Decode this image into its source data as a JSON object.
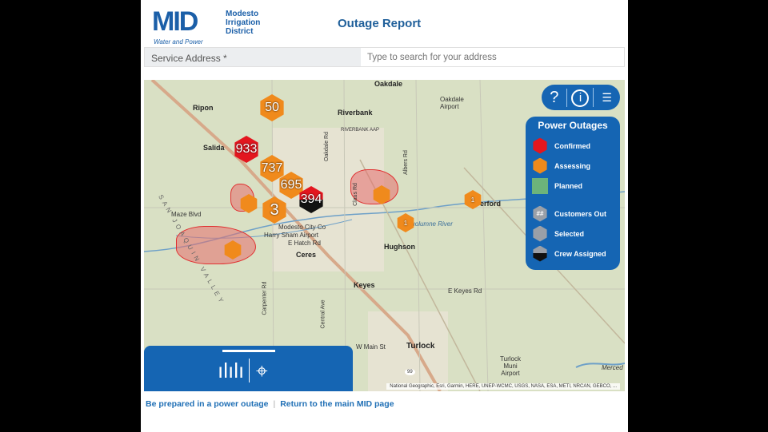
{
  "header": {
    "logo_text": "MID",
    "logo_sub": "Modesto Irrigation District",
    "logo_tagline": "Water and Power",
    "title": "Outage Report"
  },
  "search": {
    "label": "Service Address *",
    "placeholder": "Type to search for your address"
  },
  "map": {
    "labels": [
      "Oakdale",
      "Oakdale Airport",
      "Ripon",
      "Riverbank",
      "RIVERBANK AAP",
      "Salida",
      "Maze Blvd",
      "Modesto City Co",
      "Harry Sham Airport",
      "E Hatch Rd",
      "Ceres",
      "Hughson",
      "Keyes",
      "E Keyes Rd",
      "Turlock",
      "W Main St",
      "Turlock Muni Airport",
      "Merced",
      "Tuolumne River",
      "erford",
      "SAN JOAQUIN VALLEY",
      "Claus Rd",
      "Albers Rd",
      "Oakdale Rd",
      "Carpenter Rd",
      "Central Ave",
      "99"
    ],
    "markers": [
      {
        "count": "50",
        "status": "assessing"
      },
      {
        "count": "933",
        "status": "confirmed"
      },
      {
        "count": "737",
        "status": "assessing"
      },
      {
        "count": "695",
        "status": "assessing"
      },
      {
        "count": "394",
        "status": "crew assigned"
      },
      {
        "count": "3",
        "status": "assessing"
      },
      {
        "count": "1",
        "status": "assessing"
      },
      {
        "count": "1",
        "status": "assessing"
      }
    ],
    "attribution": "National Geographic, Esri, Garmin, HERE, UNEP-WCMC, USGS, NASA, ESA, METI, NRCAN, GEBCO, ..."
  },
  "toolbar": {
    "help": "?",
    "info": "i",
    "layers": "layers-list-icon"
  },
  "legend": {
    "title": "Power Outages",
    "items": [
      {
        "label": "Confirmed",
        "color": "#e3161f"
      },
      {
        "label": "Assessing",
        "color": "#f08a1c"
      },
      {
        "label": "Planned",
        "color": "#6db37a"
      },
      {
        "label": "Customers Out",
        "symbol": "##"
      },
      {
        "label": "Selected",
        "color": "#9aa0a8"
      },
      {
        "label": "Crew Assigned"
      }
    ]
  },
  "bottom_panel": {
    "icons": [
      "chart-icon",
      "map-pin-icon"
    ]
  },
  "footer": {
    "link1": "Be prepared in a power outage",
    "separator": "|",
    "link2": "Return to the main MID page"
  }
}
